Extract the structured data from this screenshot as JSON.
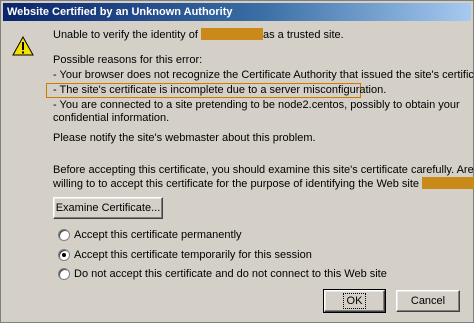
{
  "dialog": {
    "title": "Website Certified by an Unknown Authority",
    "unable_prefix": "Unable to verify the identity of",
    "unable_suffix": "as a trusted site.",
    "possible_reasons": "Possible reasons for this error:",
    "reasons": [
      "- Your browser does not recognize the Certificate Authority that issued the site's certificate.",
      "- The site's certificate is incomplete due to a server misconfiguration.",
      "- You are connected to a site pretending to be node2.centos, possibly to obtain your",
      "confidential information."
    ],
    "notify": "Please notify the site's webmaster about this problem.",
    "before_accepting_line1": "Before accepting this certificate, you should examine this site's certificate carefully. Are you",
    "before_accepting_line2": "willing to to accept this certificate for the purpose of identifying the Web site",
    "before_accepting_suffix": "?",
    "examine_button": "Examine Certificate...",
    "options": [
      {
        "label": "Accept this certificate permanently",
        "selected": false
      },
      {
        "label": "Accept this certificate temporarily for this session",
        "selected": true
      },
      {
        "label": "Do not accept this certificate and do not connect to this Web site",
        "selected": false
      }
    ],
    "ok_button": "OK",
    "cancel_button": "Cancel"
  },
  "colors": {
    "title_bar": "#0a246a",
    "dialog_bg": "#d4d0c8",
    "highlight": "#d07b00",
    "redaction": "#c98a1a"
  },
  "icons": {
    "warning": "warning-triangle-icon"
  }
}
